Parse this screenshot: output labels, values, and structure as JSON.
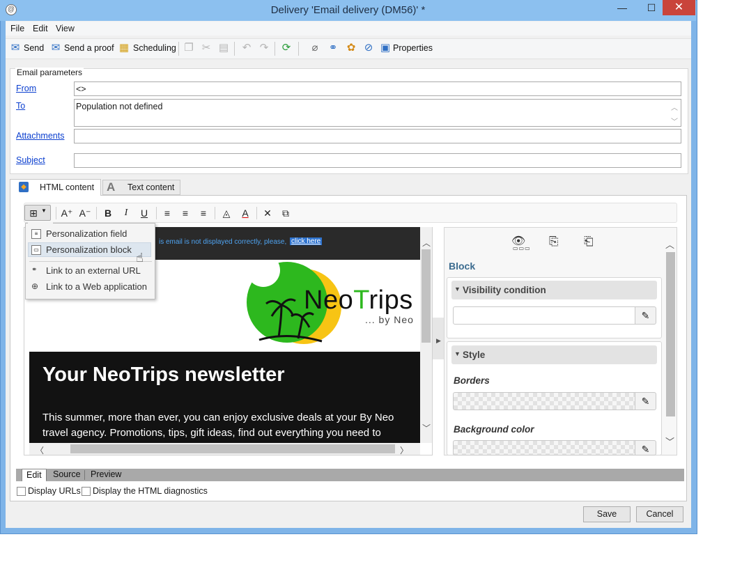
{
  "window": {
    "title": "Delivery 'Email delivery (DM56)' *",
    "min_glyph": "—",
    "max_glyph": "☐",
    "close_glyph": "✕"
  },
  "menu": {
    "items": [
      "File",
      "Edit",
      "View"
    ]
  },
  "toolbar": {
    "send": "Send",
    "send_proof": "Send a proof",
    "scheduling": "Scheduling",
    "properties": "Properties"
  },
  "params": {
    "section_title": "Email parameters",
    "from_label": "From",
    "from_value": "<>",
    "to_label": "To",
    "to_value": "Population not defined",
    "attachments_label": "Attachments",
    "attachments_value": "",
    "subject_label": "Subject",
    "subject_value": ""
  },
  "tabs": {
    "html": "HTML content",
    "text": "Text content"
  },
  "editor": {
    "insert_menu": [
      "Personalization field",
      "Personalization block",
      "Link to an external URL",
      "Link to a Web application"
    ]
  },
  "preview": {
    "not_displayed": "is email is not displayed correctly, please,",
    "click_here": "click here",
    "logo_name_part1": "Neo",
    "logo_name_part2": "Trips",
    "logo_byline": "... by Neo",
    "heading": "Your NeoTrips newsletter",
    "body": "This summer, more than ever, you can enjoy exclusive deals at your By Neo travel agency. Promotions, tips, gift ideas, find out everything you need to"
  },
  "panel": {
    "title": "Block",
    "visibility": "Visibility condition",
    "style": "Style",
    "borders": "Borders",
    "background": "Background color"
  },
  "bottom_tabs": [
    "Edit",
    "Source",
    "Preview"
  ],
  "checkboxes": {
    "display_urls": "Display URLs",
    "html_diag": "Display the HTML diagnostics"
  },
  "buttons": {
    "save": "Save",
    "cancel": "Cancel"
  },
  "colors": {
    "titlebar": "#8cc0ef",
    "link": "#0b3fcf",
    "logo_green": "#2db81e",
    "logo_yellow": "#f7c414",
    "dark_bg": "#121212"
  }
}
